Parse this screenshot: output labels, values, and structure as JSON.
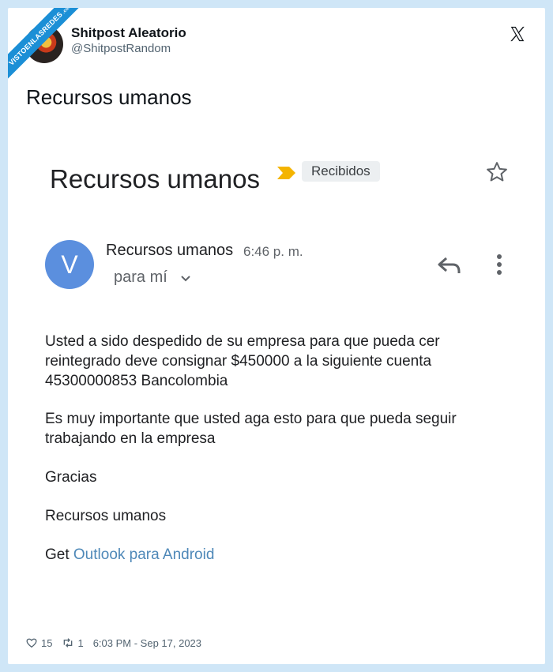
{
  "watermark": {
    "main": "VISTOENLASREDES",
    "sub": ".com"
  },
  "tweet": {
    "display_name": "Shitpost Aleatorio",
    "handle": "@ShitpostRandom",
    "text": "Recursos umanos",
    "likes": "15",
    "retweets": "1",
    "timestamp": "6:03 PM - Sep 17, 2023"
  },
  "email": {
    "subject": "Recursos umanos",
    "label": "Recibidos",
    "sender_initial": "V",
    "sender_name": "Recursos umanos",
    "time": "6:46 p. m.",
    "recipient": "para mí",
    "body": {
      "p1_l1": "Usted a sido despedido de su empresa para que pueda cer",
      "p1_l2": "reintegrado deve consignar $450000 a la siguiente cuenta",
      "p1_l3": "45300000853 Bancolombia",
      "p2_l1": "Es muy importante que usted aga esto para que pueda seguir",
      "p2_l2": "trabajando en la empresa",
      "p3": "Gracias",
      "p4": "Recursos umanos",
      "sig_prefix": "Get",
      "sig_link": "Outlook para Android"
    }
  },
  "colors": {
    "accent_blue": "#1b8fd6",
    "avatar_blue": "#5b8fde",
    "tag_yellow": "#f4b400",
    "link": "#4e88b8"
  }
}
